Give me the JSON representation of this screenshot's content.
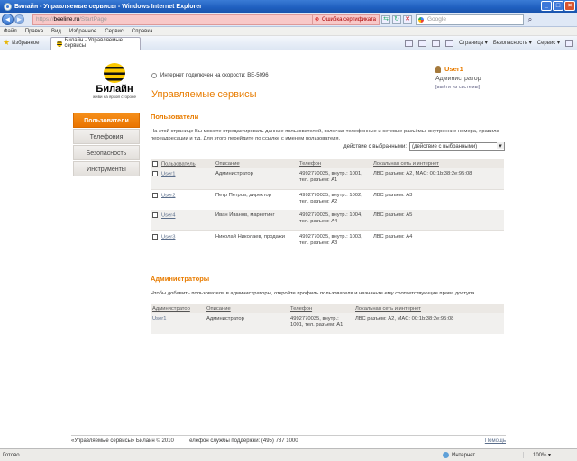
{
  "window": {
    "title": "Билайн - Управляемые сервисы - Windows Internet Explorer",
    "minimize": "_",
    "maximize": "□",
    "close": "×"
  },
  "address": {
    "url_prefix": "https://",
    "url_domain": "beeline.ru",
    "url_suffix": "/StartPage",
    "cert_error": "Ошибка сертификата",
    "search_placeholder": "Google"
  },
  "menu": [
    "Файл",
    "Правка",
    "Вид",
    "Избранное",
    "Сервис",
    "Справка"
  ],
  "favbar": {
    "favorites": "Избранное",
    "tab": "Билайн - Управляемые сервисы",
    "commands": [
      "Страница ▾",
      "Безопасность ▾",
      "Сервис ▾"
    ]
  },
  "logo": {
    "brand": "Билайн",
    "slogan": "живи на яркой стороне"
  },
  "header": {
    "speed": "Интернет подключен на скорости: ВЕ-5096",
    "title": "Управляемые сервисы"
  },
  "user": {
    "name": "User1",
    "role": "Администратор",
    "logout": "[выйти из системы]"
  },
  "sidebar": {
    "items": [
      {
        "label": "Пользователи"
      },
      {
        "label": "Телефония"
      },
      {
        "label": "Безопасность"
      },
      {
        "label": "Инструменты"
      }
    ]
  },
  "users": {
    "title": "Пользователи",
    "description": "На этой странице Вы можете отредактировать данные пользователей, включая телефонные и сетевые разъёмы, внутренние номера, правила переадресации и т.д. Для этого перейдите по ссылке с именем пользователя.",
    "action_label": "действие с выбранными:",
    "action_select": "(действие с выбранными)",
    "columns": [
      "Пользователь",
      "Описание",
      "Телефон",
      "Локальная сеть и интернет"
    ],
    "rows": [
      {
        "user": "User1",
        "desc": "Администратор",
        "phone": "4992770035, внутр.: 1001, тел. разъем: A1",
        "lan": "ЛВС разъем: A2, MAC: 00:1b:38:2e:95:08"
      },
      {
        "user": "User2",
        "desc": "Петр Петров, директор",
        "phone": "4992770035, внутр.: 1002, тел. разъем: A2",
        "lan": "ЛВС разъем: A3"
      },
      {
        "user": "User4",
        "desc": "Иван Иванов, маркетинг",
        "phone": "4992770035, внутр.: 1004, тел. разъем: A4",
        "lan": "ЛВС разъем: A5"
      },
      {
        "user": "User3",
        "desc": "Николай Николаев, продажи",
        "phone": "4992770035, внутр.: 1003, тел. разъем: A3",
        "lan": "ЛВС разъем: A4"
      }
    ]
  },
  "admins": {
    "title": "Администраторы",
    "description": "Чтобы добавить пользователя в администраторы, откройте профиль пользователя и назначьте ему соответствующие права доступа.",
    "columns": [
      "Администратор",
      "Описание",
      "Телефон",
      "Локальная сеть и интернет"
    ],
    "rows": [
      {
        "user": "User1",
        "desc": "Администратор",
        "phone": "4992770035, внутр.: 1001, тел. разъем: A1",
        "lan": "ЛВС разъем: A2, MAC: 00:1b:38:2e:95:08"
      }
    ]
  },
  "footer": {
    "copyright": "«Управляемые сервисы» Билайн © 2010",
    "support": "Телефон службы поддержки: (495) 787 1000",
    "help": "Помощь"
  },
  "status": {
    "left": "Готово",
    "zone": "Интернет",
    "zoom": "100% ▾"
  }
}
